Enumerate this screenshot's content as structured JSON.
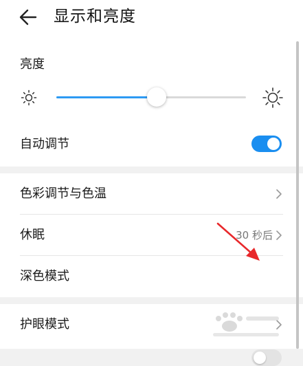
{
  "header": {
    "title": "显示和亮度",
    "back_icon": "arrow-left-icon"
  },
  "brightness": {
    "label": "亮度",
    "level": 0.53,
    "accent_color": "#2d9af3",
    "track_color": "#d9d9d9",
    "low_icon": "sun-small-icon",
    "high_icon": "sun-large-icon"
  },
  "auto_adjust": {
    "label": "自动调节",
    "enabled": true,
    "toggle_color": "#1a8ef0"
  },
  "settings": [
    {
      "label": "色彩调节与色温",
      "value": "",
      "control": "chevron"
    },
    {
      "label": "休眠",
      "value": "30 秒后",
      "control": "chevron"
    },
    {
      "label": "深色模式",
      "value": "",
      "control": "toggle",
      "enabled": false
    }
  ],
  "eye_protection": {
    "label": "护眼模式",
    "control": "chevron"
  },
  "annotation": {
    "arrow_color": "#e8282b"
  }
}
